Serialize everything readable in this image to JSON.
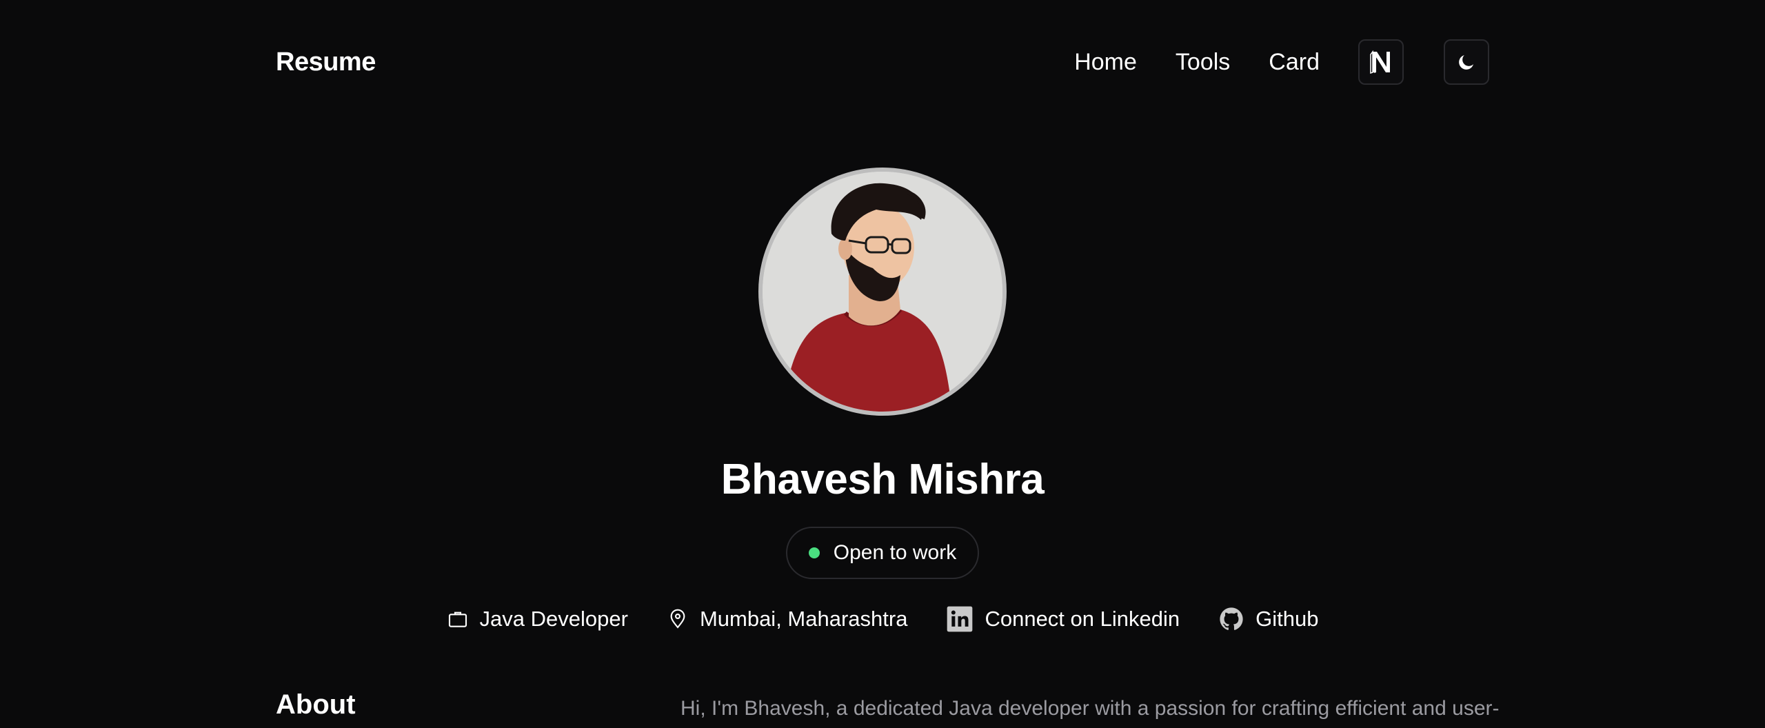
{
  "header": {
    "brand": "Resume",
    "nav": [
      {
        "label": "Home"
      },
      {
        "label": "Tools"
      },
      {
        "label": "Card"
      }
    ],
    "icons": {
      "logo_button": "notion-n-icon",
      "theme_toggle": "moon-icon"
    }
  },
  "profile": {
    "name": "Bhavesh Mishra",
    "status": "Open to work",
    "status_color": "#4ade80",
    "details": [
      {
        "icon": "briefcase-icon",
        "label": "Java Developer"
      },
      {
        "icon": "map-pin-icon",
        "label": "Mumbai, Maharashtra"
      },
      {
        "icon": "linkedin-icon",
        "label": "Connect on Linkedin"
      },
      {
        "icon": "github-icon",
        "label": "Github"
      }
    ]
  },
  "about": {
    "heading": "About",
    "text": "Hi, I'm Bhavesh, a dedicated Java developer with a passion for crafting efficient and user-"
  },
  "colors": {
    "background": "#0a0a0b",
    "muted_text": "#9b9ba1",
    "border": "#2a2a2e"
  }
}
